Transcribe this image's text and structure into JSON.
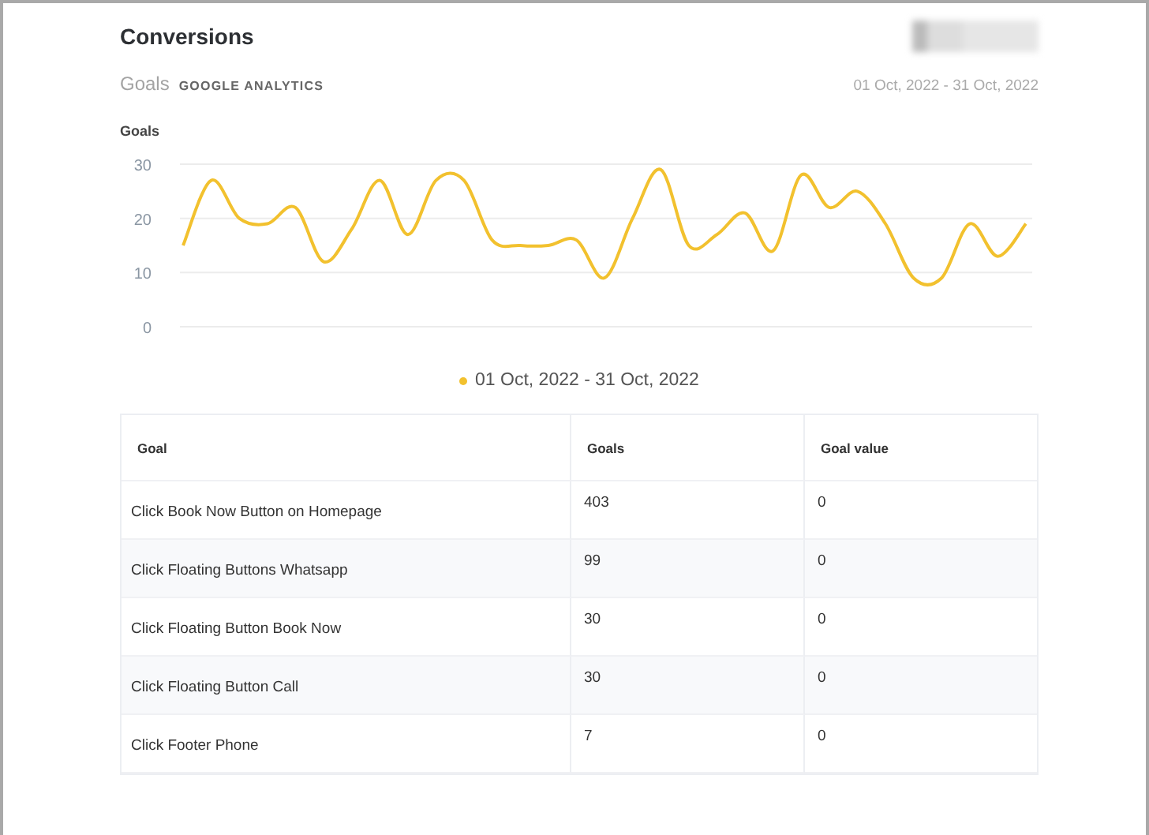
{
  "header": {
    "title": "Conversions"
  },
  "section": {
    "title": "Goals",
    "source": "GOOGLE ANALYTICS",
    "date_range": "01 Oct, 2022 - 31 Oct, 2022"
  },
  "chart": {
    "label": "Goals",
    "chart_data": {
      "type": "line",
      "ylim": [
        0,
        30
      ],
      "yticks": [
        0,
        10,
        20,
        30
      ],
      "series": [
        {
          "name": "01 Oct, 2022 - 31 Oct, 2022",
          "color": "#f2c12e",
          "values": [
            15,
            27,
            20,
            19,
            22,
            12,
            18,
            27,
            17,
            27,
            27,
            16,
            15,
            15,
            16,
            9,
            20,
            29,
            15,
            17,
            21,
            14,
            28,
            22,
            25,
            19,
            9,
            9,
            19,
            13,
            19
          ]
        }
      ]
    }
  },
  "table": {
    "columns": [
      "Goal",
      "Goals",
      "Goal value"
    ],
    "rows": [
      [
        "Click Book Now Button on Homepage",
        "403",
        "0"
      ],
      [
        "Click Floating Buttons Whatsapp",
        "99",
        "0"
      ],
      [
        "Click Floating Button Book Now",
        "30",
        "0"
      ],
      [
        "Click Floating Button Call",
        "30",
        "0"
      ],
      [
        "Click Footer Phone",
        "7",
        "0"
      ]
    ]
  }
}
